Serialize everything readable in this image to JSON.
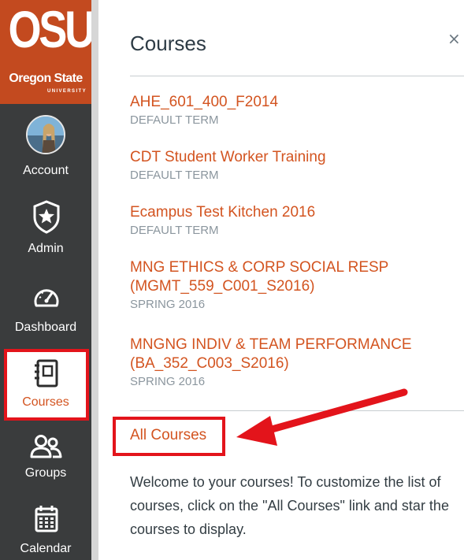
{
  "logo": {
    "main": "OSU",
    "sub": "Oregon State",
    "tag": "UNIVERSITY"
  },
  "nav": {
    "items": [
      {
        "label": "Account"
      },
      {
        "label": "Admin"
      },
      {
        "label": "Dashboard"
      },
      {
        "label": "Courses"
      },
      {
        "label": "Groups"
      },
      {
        "label": "Calendar"
      }
    ]
  },
  "tray": {
    "title": "Courses",
    "close": "×",
    "courses": [
      {
        "name": "AHE_601_400_F2014",
        "term": "DEFAULT TERM"
      },
      {
        "name": "CDT Student Worker Training",
        "term": "DEFAULT TERM"
      },
      {
        "name": "Ecampus Test Kitchen 2016",
        "term": "DEFAULT TERM"
      },
      {
        "name_line1": "MNG ETHICS & CORP SOCIAL RESP",
        "name_line2": "(MGMT_559_C001_S2016)",
        "term": "SPRING 2016"
      },
      {
        "name_line1": "MNGNG INDIV & TEAM PERFORMANCE",
        "name_line2": "(BA_352_C003_S2016)",
        "term": "SPRING 2016"
      }
    ],
    "all_courses": "All Courses",
    "welcome": "Welcome to your courses! To customize the list of courses, click on the \"All Courses\" link and star the courses to display."
  },
  "colors": {
    "nav_bg": "#3a3c3d",
    "brand": "#c34a1f",
    "link": "#d35420",
    "highlight": "#e3141b"
  }
}
